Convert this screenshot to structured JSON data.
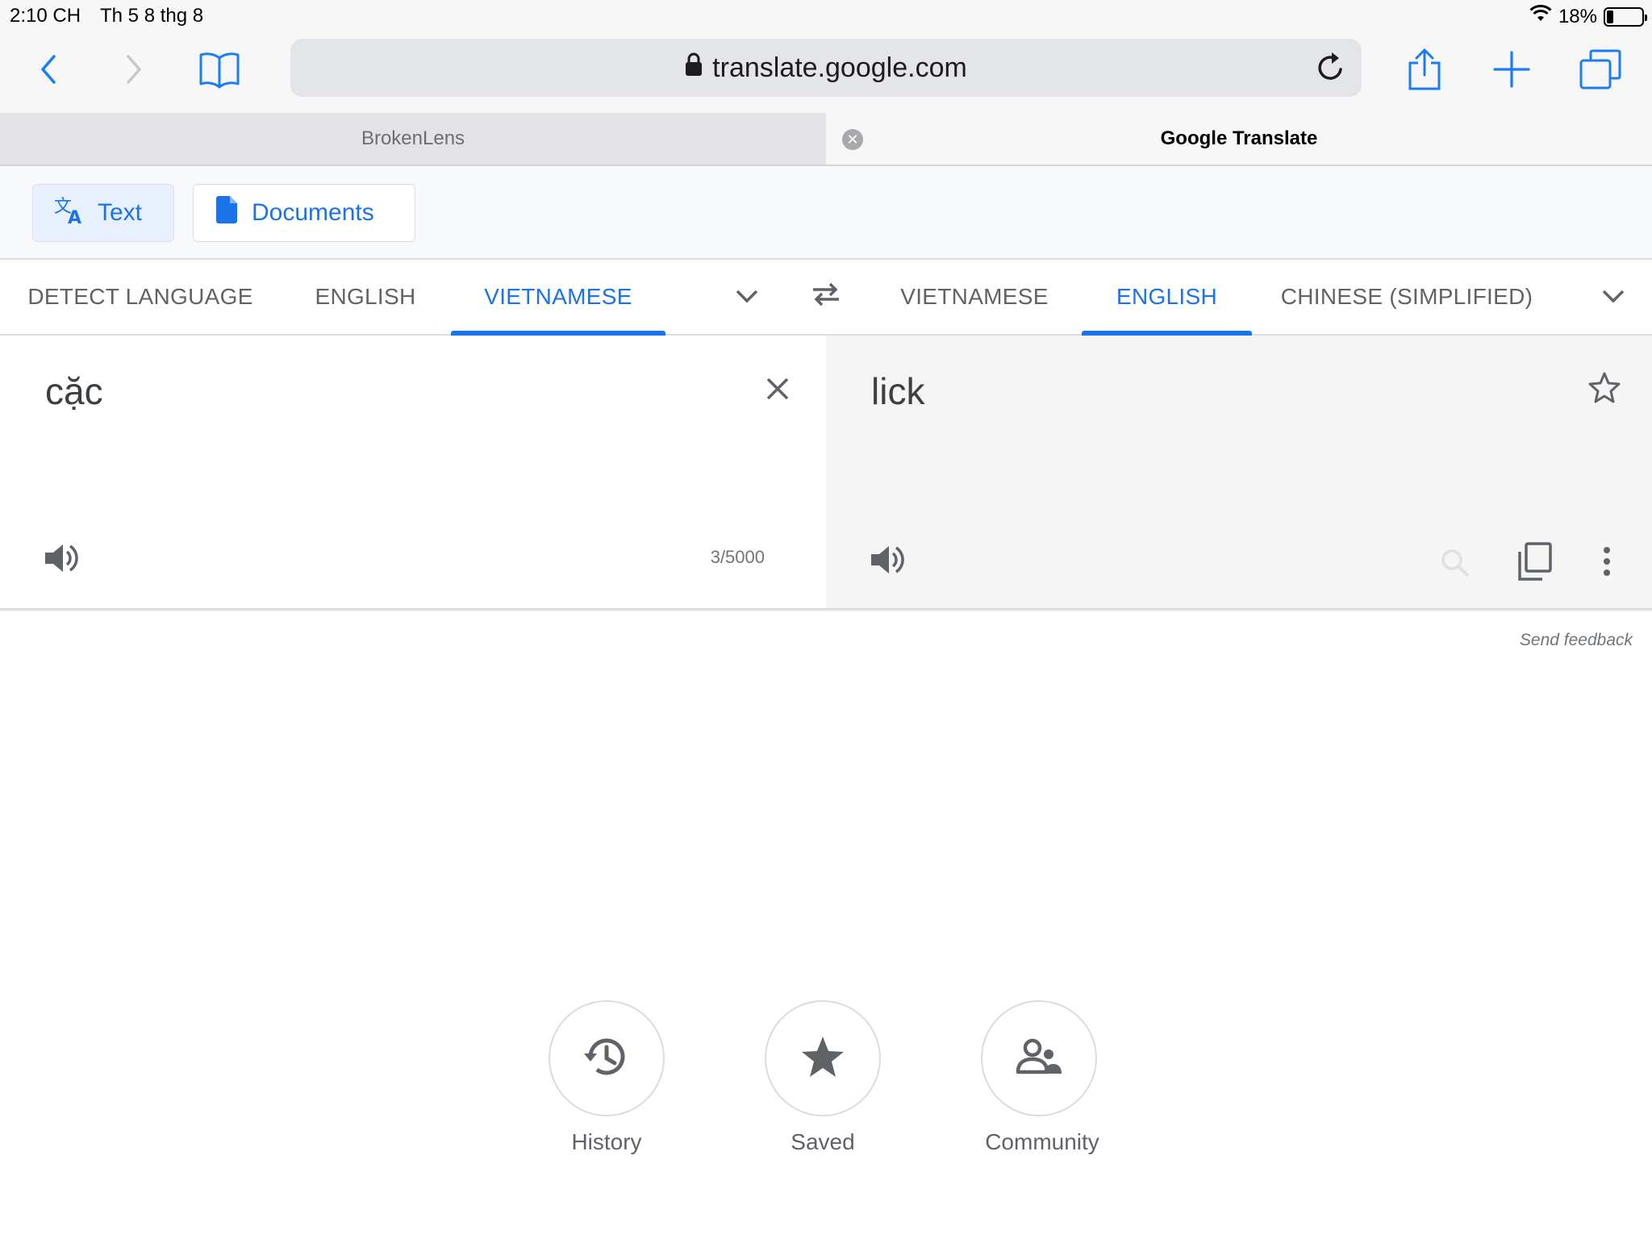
{
  "status": {
    "time": "2:10 CH",
    "date": "Th 5 8 thg 8",
    "battery": "18%",
    "battery_level": 0.18
  },
  "browser": {
    "url": "translate.google.com",
    "tabs": [
      {
        "label": "BrokenLens"
      },
      {
        "label": "Google Translate"
      }
    ],
    "icons": [
      "back-icon",
      "forward-icon",
      "bookmarks-icon",
      "lock-icon",
      "reload-icon",
      "share-icon",
      "new-tab-icon",
      "tabs-icon"
    ]
  },
  "modes": {
    "text": "Text",
    "documents": "Documents"
  },
  "source_langs": [
    "DETECT LANGUAGE",
    "ENGLISH",
    "VIETNAMESE"
  ],
  "target_langs": [
    "VIETNAMESE",
    "ENGLISH",
    "CHINESE (SIMPLIFIED)"
  ],
  "source": {
    "text": "cặc",
    "char_count": "3/5000"
  },
  "target": {
    "text": "lick"
  },
  "feedback": "Send feedback",
  "bottom": {
    "history": "History",
    "saved": "Saved",
    "community": "Community"
  },
  "colors": {
    "accent": "#1a73e8",
    "grey_text": "#5f6368",
    "ios_blue": "#1b7cf4"
  }
}
